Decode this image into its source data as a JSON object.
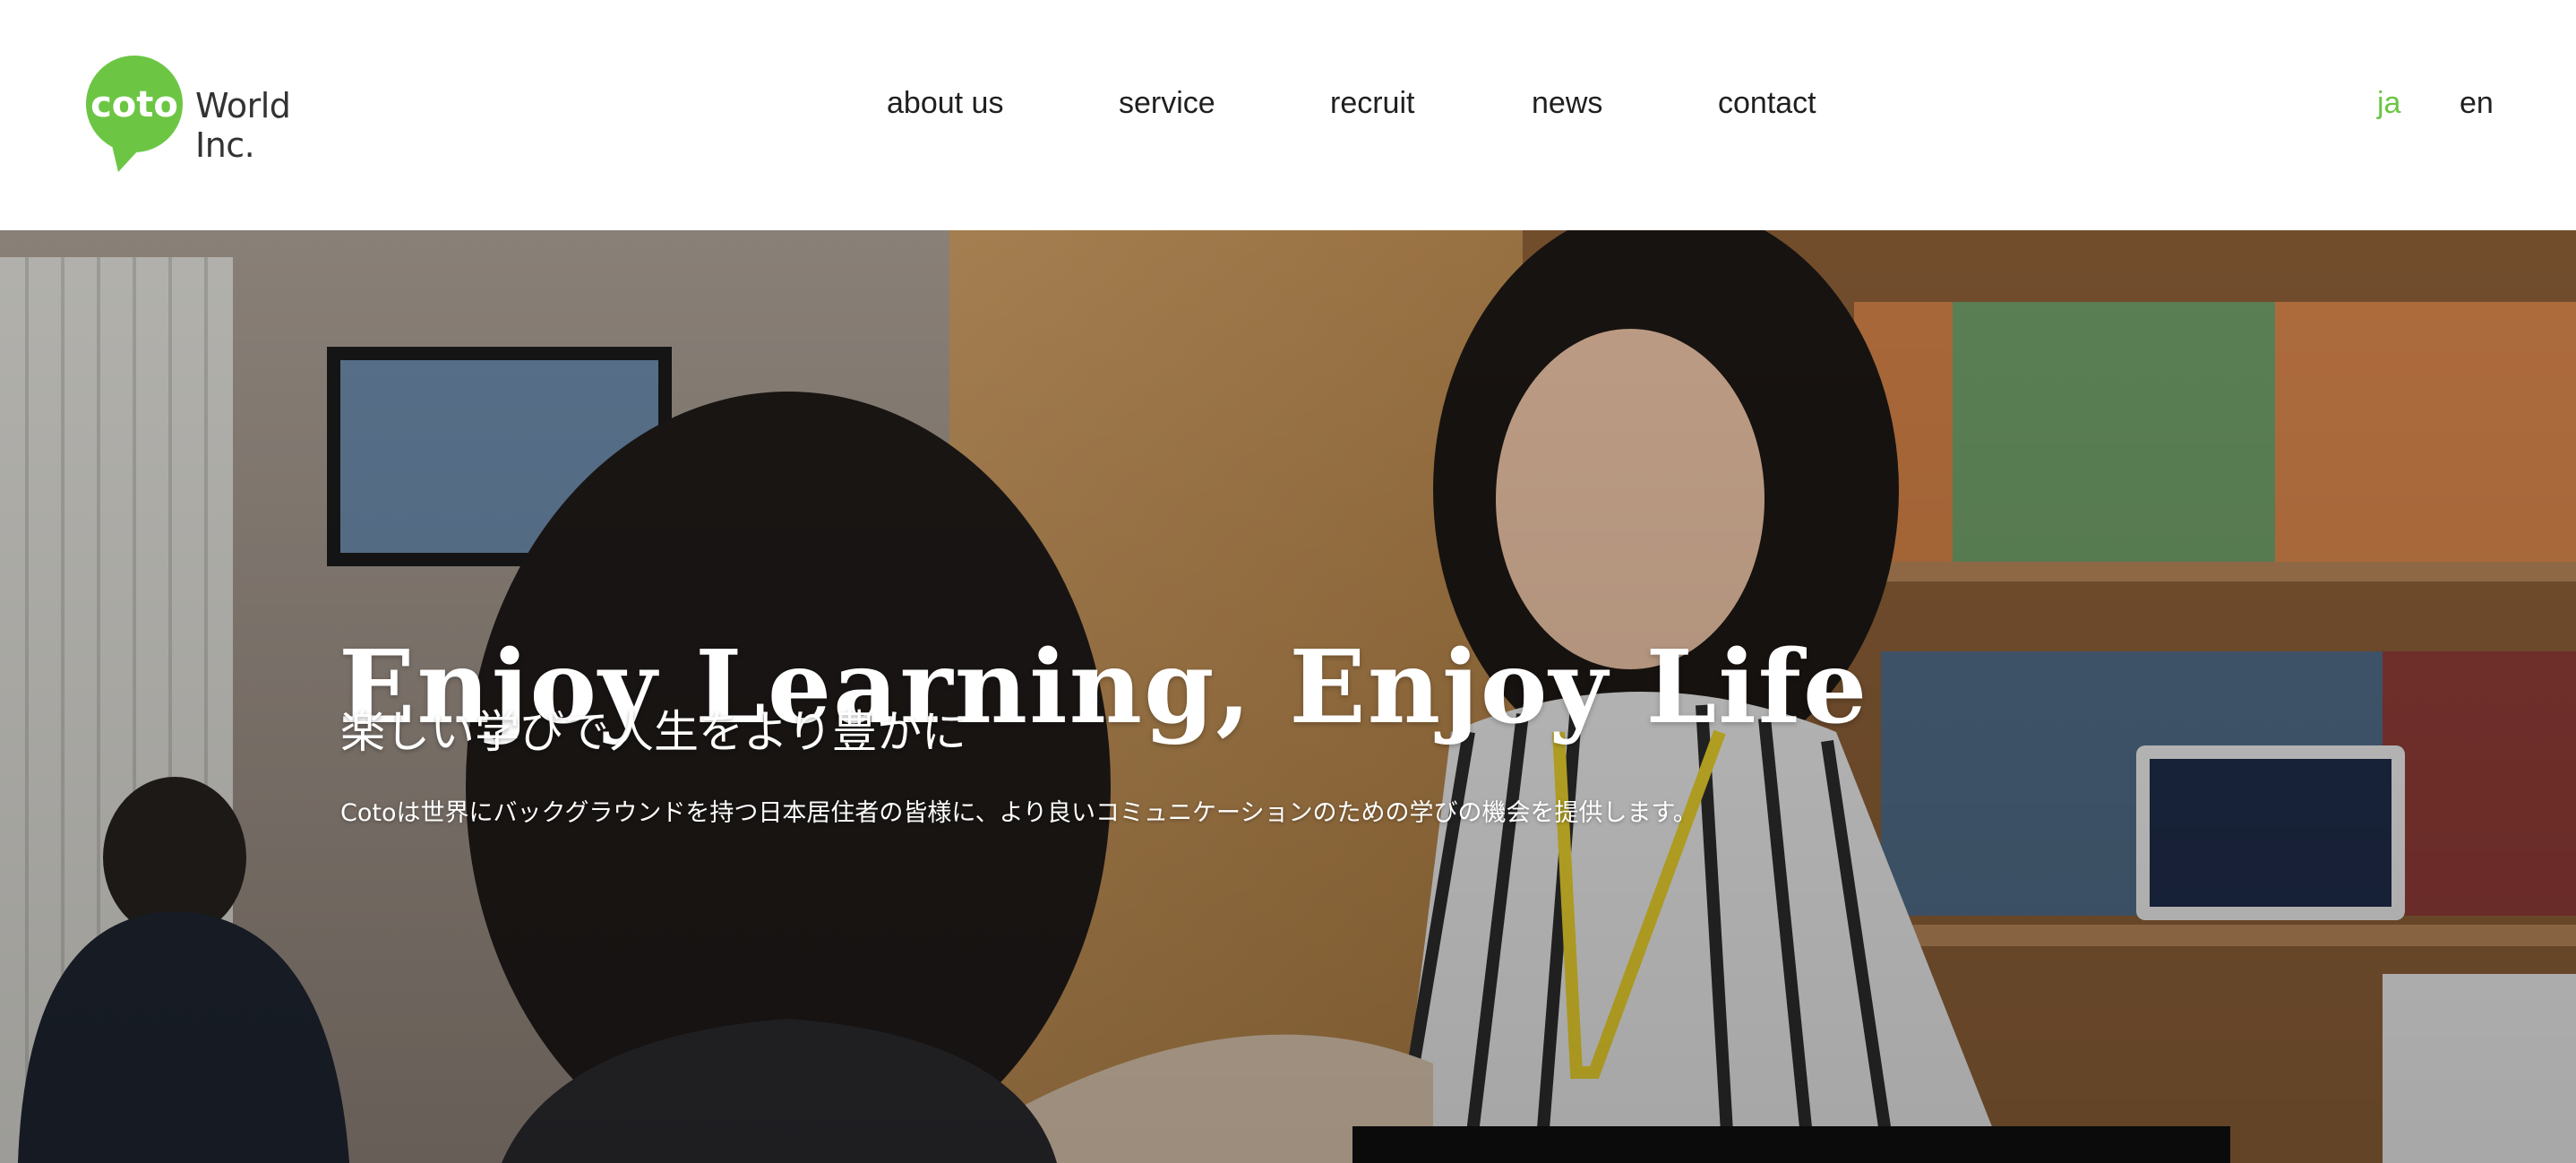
{
  "brand": {
    "logo_text": "coto",
    "company_text": "World Inc.",
    "logo_color": "#6cc644"
  },
  "nav": {
    "items": [
      {
        "label": "about us"
      },
      {
        "label": "service"
      },
      {
        "label": "recruit"
      },
      {
        "label": "news"
      },
      {
        "label": "contact"
      }
    ]
  },
  "language": {
    "options": [
      "ja",
      "en"
    ],
    "active": "ja",
    "active_color": "#6cc644"
  },
  "hero": {
    "title": "Enjoy Learning, Enjoy Life",
    "subtitle": "楽しい学びで人生をより豊かに",
    "description": "Cotoは世界にバックグラウンドを持つ日本居住者の皆様に、より良いコミュニケーションのための学びの機会を提供します。",
    "image_icon": "photo-classroom-scene"
  }
}
